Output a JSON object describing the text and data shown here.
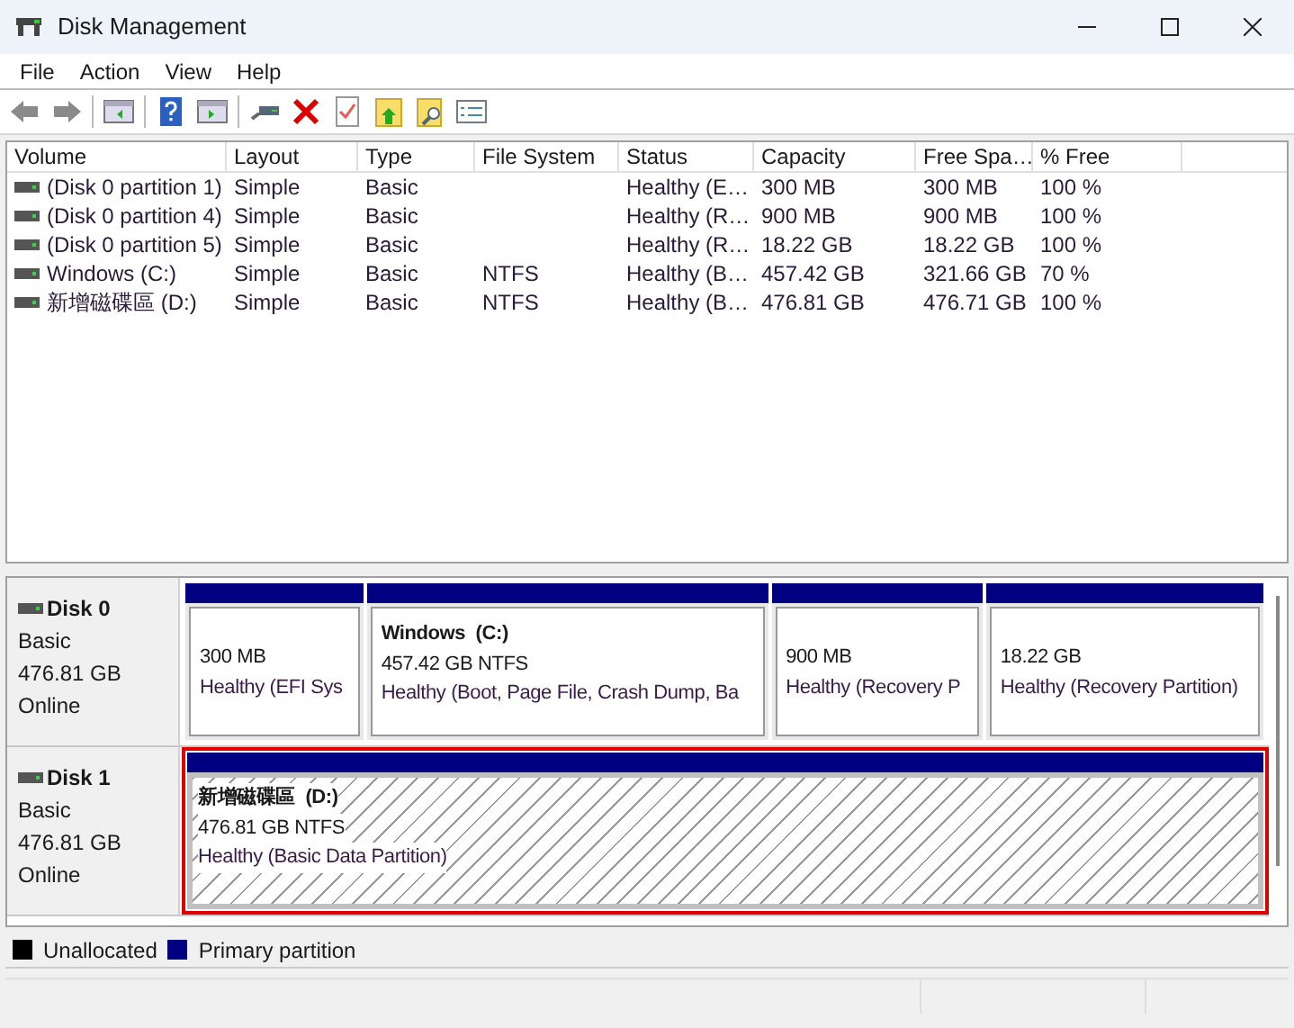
{
  "window": {
    "title": "Disk Management"
  },
  "menu": [
    "File",
    "Action",
    "View",
    "Help"
  ],
  "volume_list": {
    "columns": [
      "Volume",
      "Layout",
      "Type",
      "File System",
      "Status",
      "Capacity",
      "Free Spa…",
      "% Free"
    ],
    "rows": [
      {
        "cells": [
          "(Disk 0 partition 1)",
          "Simple",
          "Basic",
          "",
          "Healthy (E…",
          "300 MB",
          "300 MB",
          "100 %"
        ]
      },
      {
        "cells": [
          "(Disk 0 partition 4)",
          "Simple",
          "Basic",
          "",
          "Healthy (R…",
          "900 MB",
          "900 MB",
          "100 %"
        ]
      },
      {
        "cells": [
          "(Disk 0 partition 5)",
          "Simple",
          "Basic",
          "",
          "Healthy (R…",
          "18.22 GB",
          "18.22 GB",
          "100 %"
        ]
      },
      {
        "cells": [
          "Windows (C:)",
          "Simple",
          "Basic",
          "NTFS",
          "Healthy (B…",
          "457.42 GB",
          "321.66 GB",
          "70 %"
        ]
      },
      {
        "cells": [
          "新增磁碟區 (D:)",
          "Simple",
          "Basic",
          "NTFS",
          "Healthy (B…",
          "476.81 GB",
          "476.71 GB",
          "100 %"
        ]
      }
    ]
  },
  "disks": [
    {
      "name": "Disk 0",
      "type": "Basic",
      "size": "476.81 GB",
      "status": "Online",
      "partitions": [
        {
          "size": "300 MB",
          "status": "Healthy (EFI Sys",
          "selected": false
        },
        {
          "title": "Windows  (C:)",
          "size": "457.42 GB NTFS",
          "status": "Healthy (Boot, Page File, Crash Dump, Ba",
          "selected": false
        },
        {
          "size": "900 MB",
          "status": "Healthy (Recovery P",
          "selected": false
        },
        {
          "size": "18.22 GB",
          "status": "Healthy (Recovery Partition)",
          "selected": false
        }
      ]
    },
    {
      "name": "Disk 1",
      "type": "Basic",
      "size": "476.81 GB",
      "status": "Online",
      "partitions": [
        {
          "title": "新增磁碟區  (D:)",
          "size": "476.81 GB NTFS",
          "status": "Healthy (Basic Data Partition)",
          "selected": true
        }
      ]
    }
  ],
  "legend": [
    {
      "label": "Unallocated",
      "color": "#000000"
    },
    {
      "label": "Primary partition",
      "color": "#000080"
    }
  ]
}
